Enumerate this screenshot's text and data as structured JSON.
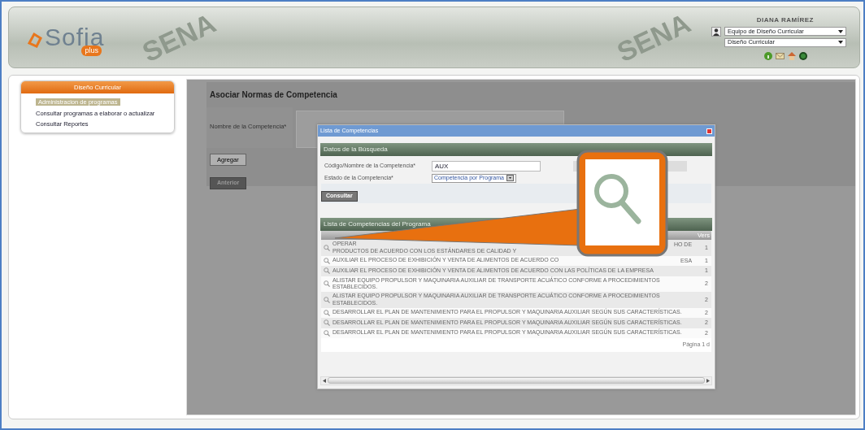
{
  "header": {
    "logo": {
      "name": "Sofia",
      "tag": "plus"
    },
    "watermarks": [
      "SENA",
      "SENA"
    ],
    "user": {
      "name": "DIANA RAMÍREZ",
      "selects": [
        {
          "value": "Equipo de Diseño Curricular"
        },
        {
          "value": "Diseño Curricular"
        }
      ]
    }
  },
  "sidebar": {
    "title": "Diseño Curricular",
    "items": [
      {
        "label": "Administracion de programas",
        "selected": true
      },
      {
        "label": "Consultar programas a elaborar o actualizar",
        "selected": false
      },
      {
        "label": "Consultar Reportes",
        "selected": false
      }
    ]
  },
  "form": {
    "title": "Asociar Normas de Competencia",
    "field_label": "Nombre de la Competencia*",
    "buttons": [
      "Agregar",
      "Anterior"
    ]
  },
  "dialog": {
    "title": "Lista de Competencias",
    "search_section": "Datos de la Búsqueda",
    "fields": [
      {
        "label": "Código/Nombre de la Competencia*",
        "kind": "text",
        "value": "AUX"
      },
      {
        "label": "Estado de la Competencia*",
        "kind": "select",
        "value": "Competencia por Programa"
      }
    ],
    "search_button": "Consultar",
    "list_section": "Lista de Competencias del Programa",
    "column_2": "Vers",
    "rows": [
      {
        "lines": [
          "OPERAR",
          "PRODUCTOS DE ACUERDO CON LOS ESTÁNDARES DE CALIDAD Y"
        ],
        "tail": "HO DE",
        "version": "1"
      },
      {
        "lines": [
          "AUXILIAR EL PROCESO DE EXHIBICIÓN Y VENTA DE ALIMENTOS DE ACUERDO CO"
        ],
        "tail": "ESA",
        "version": "1"
      },
      {
        "lines": [
          "AUXILIAR EL PROCESO DE EXHIBICIÓN Y VENTA DE ALIMENTOS DE ACUERDO CON LAS POLÍTICAS DE LA EMPRESA"
        ],
        "version": "1"
      },
      {
        "lines": [
          "ALISTAR EQUIPO PROPULSOR Y MAQUINARIA AUXILIAR DE TRANSPORTE ACUÁTICO CONFORME A PROCEDIMIENTOS",
          "ESTABLECIDOS."
        ],
        "version": "2"
      },
      {
        "lines": [
          "ALISTAR EQUIPO PROPULSOR Y MAQUINARIA AUXILIAR DE TRANSPORTE ACUÁTICO CONFORME A PROCEDIMIENTOS",
          "ESTABLECIDOS."
        ],
        "version": "2"
      },
      {
        "lines": [
          "DESARROLLAR EL PLAN DE MANTENIMIENTO PARA EL PROPULSOR Y MAQUINARIA AUXILIAR SEGÚN SUS CARACTERÍSTICAS."
        ],
        "version": "2"
      },
      {
        "lines": [
          "DESARROLLAR EL PLAN DE MANTENIMIENTO PARA EL PROPULSOR Y MAQUINARIA AUXILIAR SEGÚN SUS CARACTERÍSTICAS."
        ],
        "version": "2"
      },
      {
        "lines": [
          "DESARROLLAR EL PLAN DE MANTENIMIENTO PARA EL PROPULSOR Y MAQUINARIA AUXILIAR SEGÚN SUS CARACTERÍSTICAS."
        ],
        "version": "2"
      }
    ],
    "pagination": "Página 1 d"
  }
}
